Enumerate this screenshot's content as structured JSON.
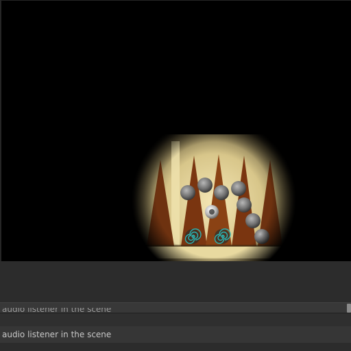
{
  "console": {
    "partial_line": "audio listener in the scene",
    "message": "audio listener in the scene"
  },
  "scene": {
    "description_icon": "backgammon-board",
    "colors": {
      "background": "#000000",
      "board_light": "#e9d9a0",
      "point_dark": "#7a3510",
      "checker": "#8c8c8c",
      "spiral_marker": "#1fa3a3"
    }
  }
}
